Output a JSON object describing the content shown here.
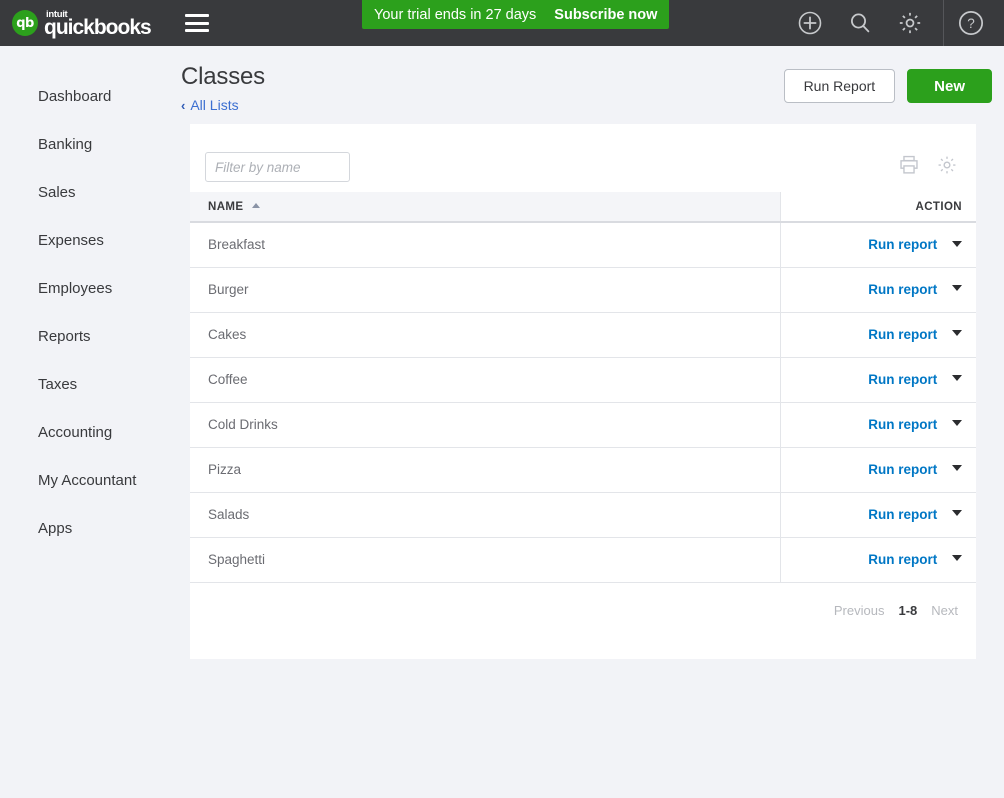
{
  "topbar": {
    "logo": {
      "mark": "qb",
      "intuit": "intuit",
      "product": "quickbooks",
      "brand_green": "#2ca01c"
    },
    "menu_icon": "hamburger-icon",
    "trial": {
      "message": "Your trial ends in 27 days",
      "cta": "Subscribe now",
      "background": "#2ca01c"
    },
    "icons": [
      "plus-circle-icon",
      "search-icon",
      "gear-icon",
      "help-circle-icon"
    ],
    "background": "#393a3d"
  },
  "sidebar": {
    "items": [
      {
        "label": "Dashboard"
      },
      {
        "label": "Banking"
      },
      {
        "label": "Sales"
      },
      {
        "label": "Expenses"
      },
      {
        "label": "Employees"
      },
      {
        "label": "Reports"
      },
      {
        "label": "Taxes"
      },
      {
        "label": "Accounting"
      },
      {
        "label": "My Accountant"
      },
      {
        "label": "Apps"
      }
    ]
  },
  "page": {
    "title": "Classes",
    "breadcrumb": {
      "chevron": "‹",
      "label": "All Lists",
      "color": "#3c6fd1"
    },
    "actions": {
      "run_report": "Run Report",
      "new": "New"
    }
  },
  "card": {
    "filter": {
      "placeholder": "Filter by name",
      "value": ""
    },
    "toolbar_icons": [
      "print-icon",
      "gear-icon"
    ],
    "table": {
      "columns": [
        "NAME",
        "ACTION"
      ],
      "sort": {
        "column": "NAME",
        "direction": "asc"
      },
      "rows": [
        {
          "name": "Breakfast",
          "action": "Run report"
        },
        {
          "name": "Burger",
          "action": "Run report"
        },
        {
          "name": "Cakes",
          "action": "Run report"
        },
        {
          "name": "Coffee",
          "action": "Run report"
        },
        {
          "name": "Cold Drinks",
          "action": "Run report"
        },
        {
          "name": "Pizza",
          "action": "Run report"
        },
        {
          "name": "Salads",
          "action": "Run report"
        },
        {
          "name": "Spaghetti",
          "action": "Run report"
        }
      ]
    },
    "pagination": {
      "previous": "Previous",
      "range": "1-8",
      "next": "Next"
    }
  }
}
